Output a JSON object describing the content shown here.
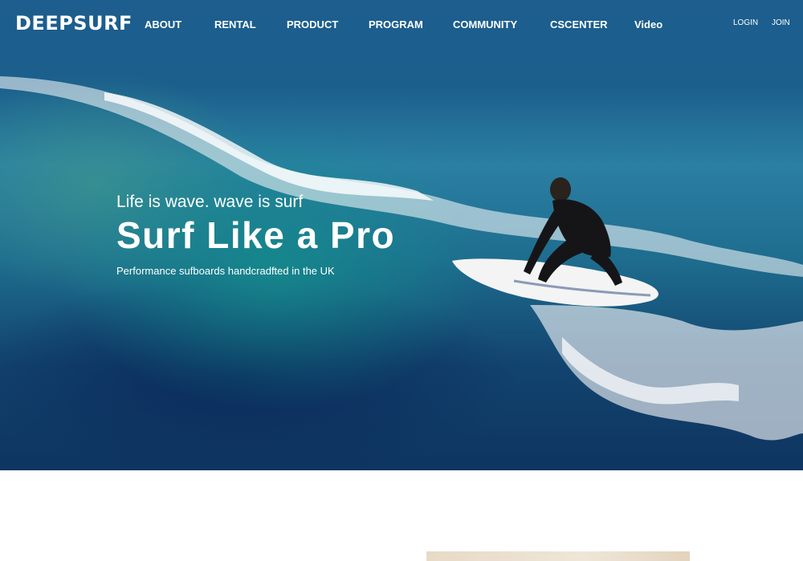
{
  "header": {
    "logo": "DEEPSURF",
    "menu": [
      "ABOUT",
      "RENTAL",
      "PRODUCT",
      "PROGRAM",
      "COMMUNITY",
      "CSCENTER",
      "Video"
    ],
    "login": "LOGIN",
    "join": "JOIN"
  },
  "hero": {
    "eyebrow": "Life is wave. wave is surf",
    "headline": "Surf Like a Pro",
    "description": "Performance sufboards handcradfted in the UK"
  }
}
